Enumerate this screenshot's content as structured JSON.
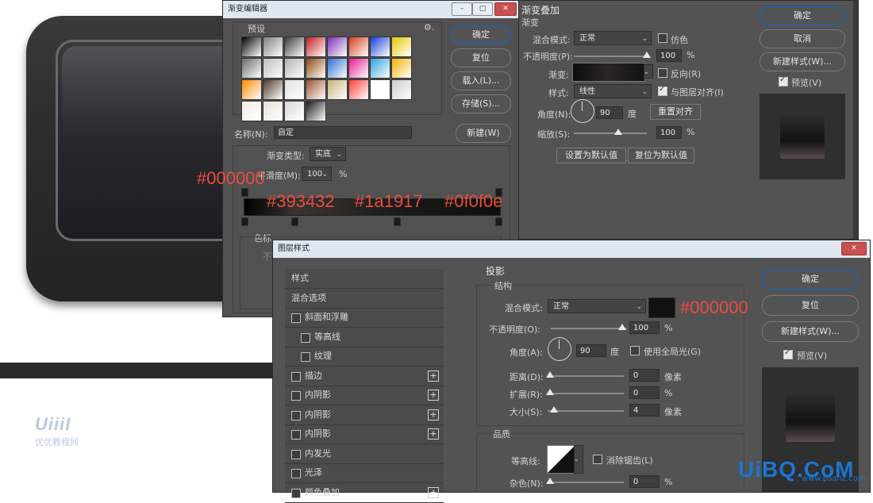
{
  "gradient_editor": {
    "title": "渐变编辑器",
    "presets_label": "预设",
    "gear_glyph": "⚙.",
    "buttons": {
      "ok": "确定",
      "reset": "复位",
      "load": "载入(L)...",
      "save": "存储(S)...",
      "new": "新建(W)"
    },
    "name_label": "名称(N):",
    "name_value": "自定",
    "type_label": "渐变类型:",
    "type_value": "实底",
    "smooth_label": "平滑度(M):",
    "smooth_value": "100",
    "smooth_unit": "%",
    "color_stop_label": "色标",
    "color_stop_hint": "不",
    "swatch_colors": [
      "#000000",
      "#7f7f7f",
      "#3a3a3a",
      "#c21d1d",
      "#7a2fb7",
      "#d83a1c",
      "#1a3ed8",
      "#e6c800",
      "#6a6a6a",
      "#bdbdbd",
      "#b3b3b3",
      "#8a4a10",
      "#2e6fd0",
      "#e61c8c",
      "#2ba3e0",
      "#f2b400",
      "#ff8a00",
      "#4d3a2a",
      "#e2e2e2",
      "#9a5530",
      "#c8b27a",
      "#ff3c3c",
      "#ffffff",
      "#cccccc",
      "#f1ece2",
      "#e8e2d7",
      "#d9d9d9",
      "#1a1a1a"
    ]
  },
  "gradient_annotations": {
    "c1": "#000000",
    "c2": "#393432",
    "c3": "#1a1917",
    "c4": "#0f0f0e"
  },
  "gradient_overlay": {
    "title": "渐变叠加",
    "subtitle": "渐变",
    "blend_label": "混合模式:",
    "blend_value": "正常",
    "dither_label": "仿色",
    "opacity_label": "不透明度(P):",
    "opacity_value": "100",
    "opacity_unit": "%",
    "gradient_label": "渐变:",
    "reverse_label": "反向(R)",
    "style_label": "样式:",
    "style_value": "线性",
    "align_label": "与图层对齐(I)",
    "angle_label": "角度(N):",
    "angle_value": "90",
    "angle_unit": "度",
    "reset_align": "重置对齐",
    "scale_label": "缩放(S):",
    "scale_value": "100",
    "scale_unit": "%",
    "make_default": "设置为默认值",
    "reset_default": "复位为默认值"
  },
  "top_right": {
    "ok": "确定",
    "cancel": "取消",
    "new_style": "新建样式(W)...",
    "preview": "预览(V)"
  },
  "layer_style": {
    "title": "图层样式",
    "sidebar": [
      {
        "label": "样式",
        "check": false,
        "plus": false,
        "indent": 0
      },
      {
        "label": "混合选项",
        "check": false,
        "plus": false,
        "indent": 0
      },
      {
        "label": "斜面和浮雕",
        "check": true,
        "plus": false,
        "indent": 0
      },
      {
        "label": "等高线",
        "check": true,
        "plus": false,
        "indent": 1
      },
      {
        "label": "纹理",
        "check": true,
        "plus": false,
        "indent": 1
      },
      {
        "label": "描边",
        "check": true,
        "plus": true,
        "indent": 0
      },
      {
        "label": "内阴影",
        "check": true,
        "plus": true,
        "indent": 0
      },
      {
        "label": "内阴影",
        "check": true,
        "plus": true,
        "indent": 0
      },
      {
        "label": "内阴影",
        "check": true,
        "plus": true,
        "indent": 0
      },
      {
        "label": "内发光",
        "check": true,
        "plus": false,
        "indent": 0
      },
      {
        "label": "光泽",
        "check": true,
        "plus": false,
        "indent": 0
      },
      {
        "label": "颜色叠加",
        "check": true,
        "plus": true,
        "indent": 0
      }
    ],
    "section": "投影",
    "structure": "结构",
    "blend_label": "混合模式:",
    "blend_value": "正常",
    "shadow_color_annotation": "#000000",
    "opacity_label": "不透明度(O):",
    "opacity_value": "100",
    "opacity_unit": "%",
    "angle_label": "角度(A):",
    "angle_value": "90",
    "angle_unit": "度",
    "global_light": "使用全局光(G)",
    "distance_label": "距离(D):",
    "distance_value": "0",
    "distance_unit": "像素",
    "spread_label": "扩展(R):",
    "spread_value": "0",
    "spread_unit": "%",
    "size_label": "大小(S):",
    "size_value": "4",
    "size_unit": "像素",
    "quality": "品质",
    "contour_label": "等高线:",
    "antialias_label": "消除锯齿(L)",
    "noise_label": "杂色(N):",
    "noise_value": "0",
    "noise_unit": "%",
    "buttons": {
      "ok": "确定",
      "reset": "复位",
      "new_style": "新建样式(W)...",
      "preview": "预览(V)"
    }
  },
  "branding": {
    "logo": "UiiiI",
    "logo_sub": "优优教程网",
    "watermark": "UiBQ.CoM",
    "watermark_sub": "www.psahz.com"
  },
  "colors": {
    "accent": "#2e5d9c",
    "annotation": "#e84d3d",
    "dialog_bg": "#535353"
  }
}
